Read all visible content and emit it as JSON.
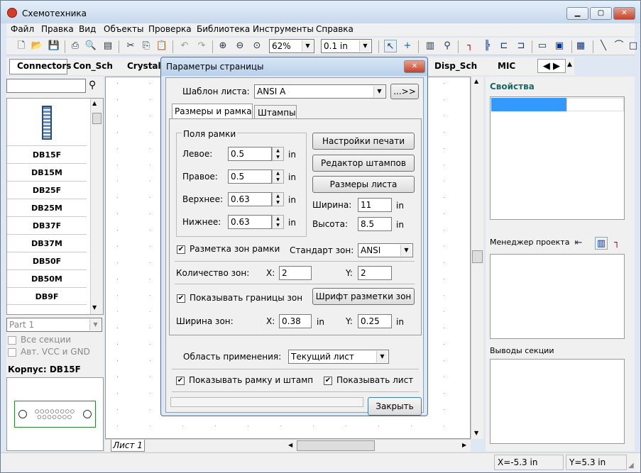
{
  "window": {
    "title": "Схемотехника",
    "min": "▁",
    "max": "▢",
    "close": "✕"
  },
  "menu": [
    "Файл",
    "Правка",
    "Вид",
    "Объекты",
    "Проверка",
    "Библиотека",
    "Инструменты",
    "Справка"
  ],
  "toolbar": {
    "zoom_value": "62%",
    "grid_value": "0.1 in",
    "icons": [
      "new-icon",
      "open-icon",
      "save-icon",
      "print-icon",
      "print-preview-icon",
      "page-icon",
      "cut-icon",
      "copy-icon",
      "paste-icon",
      "undo-icon",
      "redo-icon",
      "zoom-in-icon",
      "zoom-out-icon",
      "zoom-fit-icon"
    ]
  },
  "library_tabs": [
    "Connectors",
    "Con_Sch",
    "Crystals",
    "Disp_Sch",
    "MIC"
  ],
  "left": {
    "search_placeholder": "",
    "components": [
      "DB15F",
      "DB15M",
      "DB25F",
      "DB25M",
      "DB37F",
      "DB37M",
      "DB50F",
      "DB50M",
      "DB9F"
    ],
    "part_select": "Part 1",
    "all_sections": "Все секции",
    "auto_vcc": "Авт. VCC и GND",
    "package_label": "Корпус: DB15F"
  },
  "sheet_tab": "Лист 1",
  "right": {
    "properties_title": "Свойства",
    "project_manager": "Менеджер проекта",
    "section_pins": "Выводы секции"
  },
  "status": {
    "x": "X=-5.3 in",
    "y": "Y=5.3 in"
  },
  "dialog": {
    "title": "Параметры страницы",
    "template_label": "Шаблон листа:",
    "template_value": "ANSI A",
    "template_btn": "...>>",
    "tab_sizes": "Размеры и рамка",
    "tab_stamps": "Штампы",
    "margins_title": "Поля рамки",
    "left_label": "Левое:",
    "left_value": "0.5",
    "right_label": "Правое:",
    "right_value": "0.5",
    "top_label": "Верхнее:",
    "top_value": "0.63",
    "bottom_label": "Нижнее:",
    "bottom_value": "0.63",
    "unit": "in",
    "print_settings": "Настройки печати",
    "stamp_editor": "Редактор штампов",
    "sheet_sizes": "Размеры листа",
    "width_label": "Ширина:",
    "width_value": "11",
    "height_label": "Высота:",
    "height_value": "8.5",
    "zone_marking": "Разметка зон рамки",
    "zone_standard_label": "Стандарт зон:",
    "zone_standard_value": "ANSI",
    "zone_count_label": "Количество зон:",
    "x_label": "X:",
    "y_label": "Y:",
    "zone_count_x": "2",
    "zone_count_y": "2",
    "show_zone_borders": "Показывать границы зон",
    "zone_font": "Шрифт разметки зон",
    "zone_width_label": "Ширина зон:",
    "zone_width_x": "0.38",
    "zone_width_y": "0.25",
    "scope_label": "Область применения:",
    "scope_value": "Текущий лист",
    "show_frame": "Показывать рамку и штамп",
    "show_sheet": "Показывать лист",
    "close": "Закрыть"
  }
}
